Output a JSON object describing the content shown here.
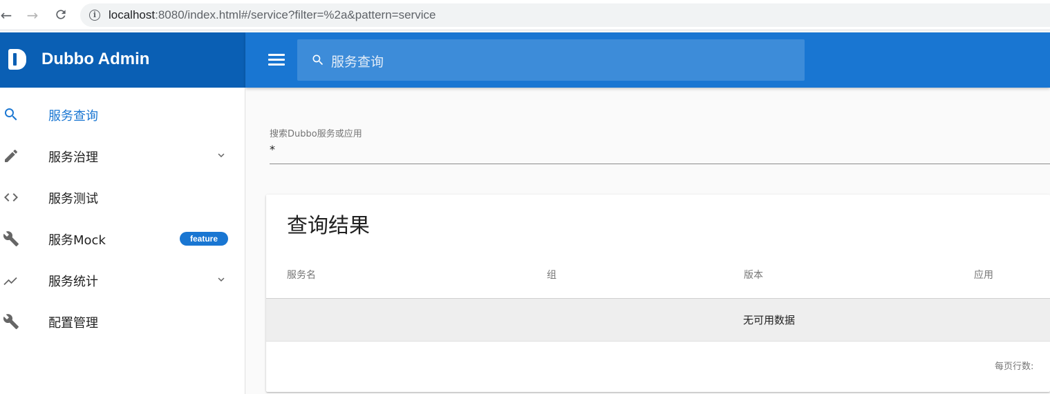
{
  "browser": {
    "url_host": "localhost",
    "url_rest": ":8080/index.html#/service?filter=%2a&pattern=service"
  },
  "header": {
    "brand_title": "Dubbo Admin",
    "search_placeholder": "服务查询",
    "brand_color": "#0a5fb4",
    "toolbar_color": "#1976d2"
  },
  "sidebar": {
    "items": [
      {
        "label": "服务查询",
        "icon": "search-icon",
        "active": true
      },
      {
        "label": "服务治理",
        "icon": "pencil-icon",
        "expandable": true
      },
      {
        "label": "服务测试",
        "icon": "code-icon"
      },
      {
        "label": "服务Mock",
        "icon": "wrench-icon",
        "badge": "feature"
      },
      {
        "label": "服务统计",
        "icon": "trending-icon",
        "expandable": true
      },
      {
        "label": "配置管理",
        "icon": "wrench-icon"
      }
    ]
  },
  "main": {
    "search_field": {
      "label": "搜索Dubbo服务或应用",
      "value": "*"
    },
    "results": {
      "title": "查询结果",
      "columns": [
        "服务名",
        "组",
        "版本",
        "应用"
      ],
      "empty_text": "无可用数据",
      "rows_per_page_label": "每页行数:"
    }
  }
}
